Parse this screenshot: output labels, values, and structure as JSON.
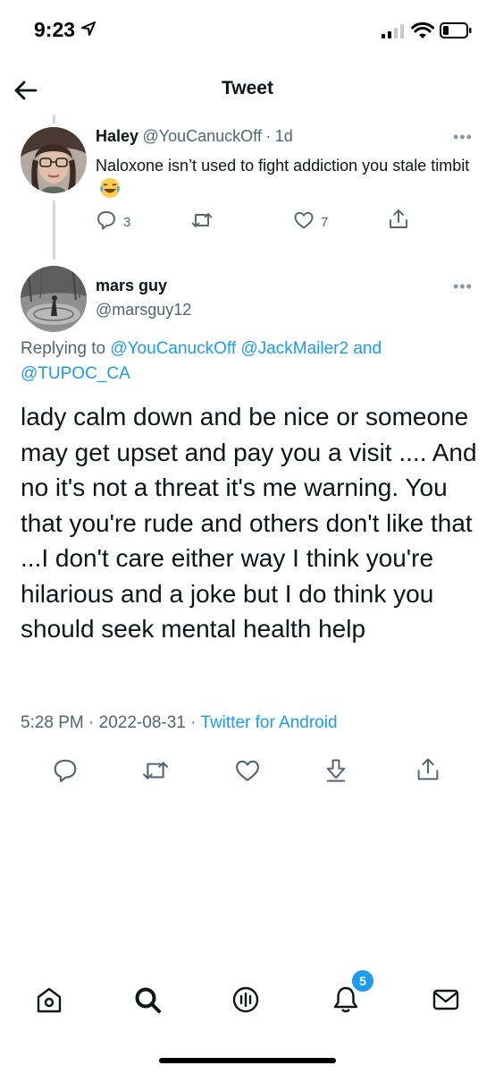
{
  "status_bar": {
    "time": "9:23"
  },
  "header": {
    "title": "Tweet"
  },
  "parent_tweet": {
    "name": "Haley",
    "handle": "@YouCanuckOff",
    "separator": "·",
    "time_ago": "1d",
    "text": "Naloxone isn’t used to fight addiction you stale timbit",
    "reply_count": "3",
    "like_count": "7"
  },
  "main_tweet": {
    "name": "mars guy",
    "handle": "@marsguy12",
    "replying_prefix": "Replying to",
    "mentions": [
      "@YouCanuckOff",
      "@JackMailer2"
    ],
    "mentions_joiner": "and",
    "mention_last": "@TUPOC_CA",
    "text": "lady calm down and be nice or someone may get upset and pay you a visit .... And no it's not a threat it's me warning. You that you're rude and others don't like that ...I don't care either way I think you're hilarious and a joke but I do think you should seek mental health help",
    "time": "5:28 PM",
    "date": "2022-08-31",
    "meta_separator": "·",
    "source": "Twitter for Android"
  },
  "tab_bar": {
    "notifications_badge": "5"
  },
  "colors": {
    "accent": "#1d9bf0",
    "secondary_text": "#536471",
    "thread_line": "#cfd9de"
  },
  "icons": {
    "status": [
      "location-arrow-icon",
      "signal-icon",
      "wifi-icon",
      "battery-icon"
    ],
    "header": [
      "back-arrow-icon"
    ],
    "tweet_actions": [
      "reply-icon",
      "retweet-icon",
      "like-icon",
      "save-icon",
      "share-icon"
    ],
    "tabs": [
      "home-icon",
      "search-icon",
      "spaces-icon",
      "notifications-icon",
      "messages-icon"
    ]
  }
}
